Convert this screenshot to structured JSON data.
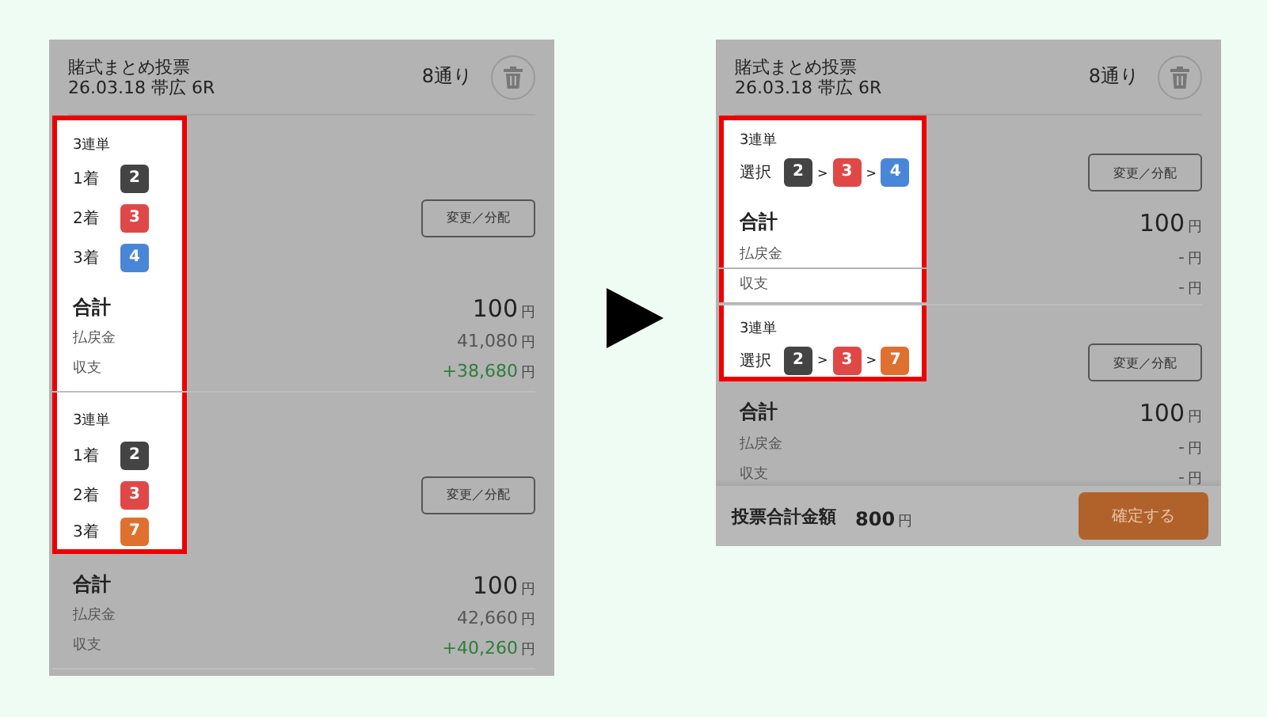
{
  "panels": [
    {
      "kind": "stacked",
      "header": {
        "title": "賭式まとめ投票",
        "subtitle": "26.03.18 帯広 6R",
        "count": "8通り"
      },
      "bets": [
        {
          "type": "3連単",
          "picks": [
            {
              "label": "1着",
              "number": "2",
              "color": "#444444"
            },
            {
              "label": "2着",
              "number": "3",
              "color": "#e04848"
            },
            {
              "label": "3着",
              "number": "4",
              "color": "#4a86d8"
            }
          ],
          "button": "変更／分配",
          "total": {
            "label": "合計",
            "value": "100",
            "unit": "円"
          },
          "payout": {
            "label": "払戻金",
            "value": "41,080",
            "unit": "円"
          },
          "balance": {
            "label": "収支",
            "value": "+38,680",
            "unit": "円",
            "positive": true
          },
          "highlight_picks": true,
          "highlight_totals": true
        },
        {
          "type": "3連単",
          "picks": [
            {
              "label": "1着",
              "number": "2",
              "color": "#444444"
            },
            {
              "label": "2着",
              "number": "3",
              "color": "#e04848"
            },
            {
              "label": "3着",
              "number": "7",
              "color": "#e07030"
            }
          ],
          "button": "変更／分配",
          "total": {
            "label": "合計",
            "value": "100",
            "unit": "円"
          },
          "payout": {
            "label": "払戻金",
            "value": "42,660",
            "unit": "円"
          },
          "balance": {
            "label": "収支",
            "value": "+40,260",
            "unit": "円",
            "positive": true
          },
          "highlight_picks": true,
          "highlight_totals": false
        }
      ]
    },
    {
      "kind": "inline",
      "header": {
        "title": "賭式まとめ投票",
        "subtitle": "26.03.18 帯広 6R",
        "count": "8通り"
      },
      "bets": [
        {
          "type": "3連単",
          "selection_label": "選択",
          "picks": [
            {
              "number": "2",
              "color": "#444444"
            },
            {
              "prefix": ">",
              "number": "3",
              "color": "#e04848"
            },
            {
              "prefix": ">",
              "number": "4",
              "color": "#4a86d8"
            }
          ],
          "button": "変更／分配",
          "total": {
            "label": "合計",
            "value": "100",
            "unit": "円"
          },
          "payout": {
            "label": "払戻金",
            "value": "-",
            "unit": "円"
          },
          "balance": {
            "label": "収支",
            "value": "-",
            "unit": "円",
            "positive": false
          },
          "highlight_picks": true,
          "highlight_totals": true
        },
        {
          "type": "3連単",
          "selection_label": "選択",
          "picks": [
            {
              "number": "2",
              "color": "#444444"
            },
            {
              "prefix": ">",
              "number": "3",
              "color": "#e04848"
            },
            {
              "prefix": ">",
              "number": "7",
              "color": "#e07030"
            }
          ],
          "button": "変更／分配",
          "total": {
            "label": "合計",
            "value": "100",
            "unit": "円"
          },
          "payout": {
            "label": "払戻金",
            "value": "-",
            "unit": "円"
          },
          "balance": {
            "label": "収支",
            "value": "-",
            "unit": "円",
            "positive": false
          },
          "highlight_picks": true,
          "highlight_totals": false
        }
      ],
      "footer": {
        "label": "投票合計金額",
        "amount": "800",
        "unit": "円",
        "button": "確定する"
      }
    }
  ]
}
